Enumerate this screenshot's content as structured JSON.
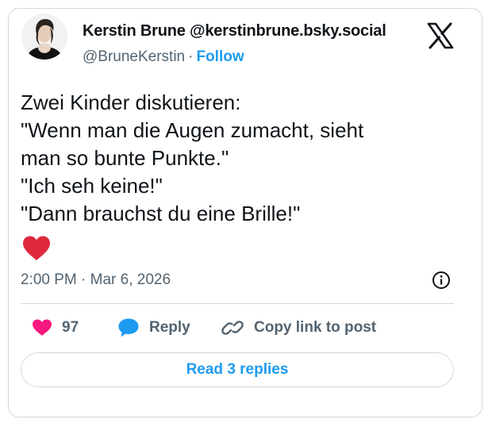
{
  "author": {
    "display_name": "Kerstin Brune",
    "bsky_handle": "@kerstinbrune.bsky.social",
    "x_handle": "@BruneKerstin",
    "separator": "·",
    "follow_label": "Follow",
    "avatar_icon": "profile-photo"
  },
  "platform_icon": "x-logo-icon",
  "tweet": {
    "lines": [
      "Zwei Kinder diskutieren:",
      "\"Wenn man die Augen zumacht, sieht",
      "man so bunte Punkte.\"",
      "\"Ich seh keine!\"",
      "\"Dann brauchst du eine Brille!\""
    ],
    "emoji": "red-heart"
  },
  "meta": {
    "time": "2:00 PM",
    "separator": "·",
    "date": "Mar 6, 2026"
  },
  "actions": {
    "likes_count": "97",
    "reply_label": "Reply",
    "copy_label": "Copy link to post"
  },
  "replies_button": "Read 3 replies",
  "colors": {
    "accent": "#1d9bf0",
    "like": "#f91880",
    "heart_emoji": "#e0283c",
    "muted": "#536471",
    "border": "#cfd9de"
  }
}
